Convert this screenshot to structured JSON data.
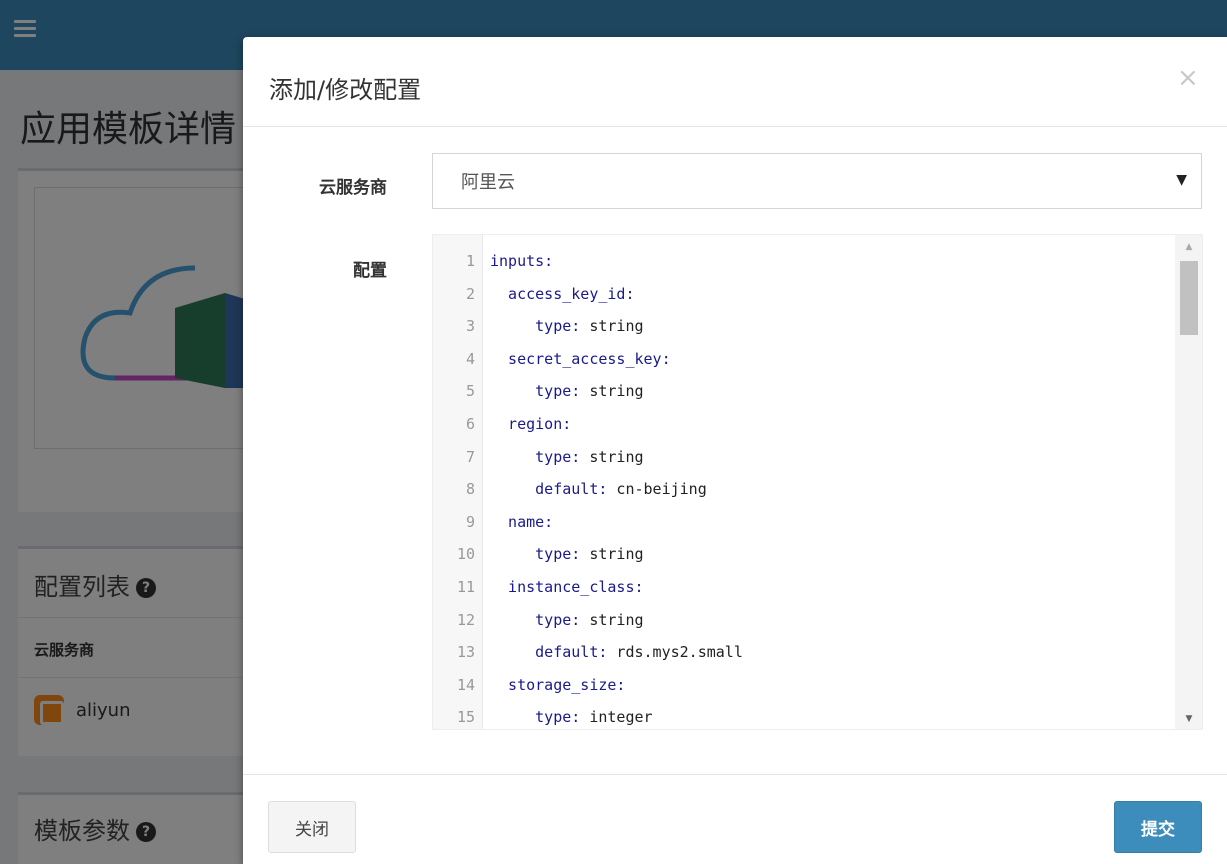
{
  "background": {
    "page_title": "应用模板详情",
    "config_list": {
      "title": "配置列表",
      "column_header": "云服务商",
      "rows": [
        {
          "provider": "aliyun"
        }
      ]
    },
    "params_title": "模板参数"
  },
  "modal": {
    "title": "添加/修改配置",
    "close_icon": "×",
    "provider_label": "云服务商",
    "provider_value": "阿里云",
    "config_label": "配置",
    "config_lines": [
      {
        "n": "1",
        "key": "inputs:",
        "val": ""
      },
      {
        "n": "2",
        "key": "  access_key_id:",
        "val": ""
      },
      {
        "n": "3",
        "key": "     type:",
        "val": " string"
      },
      {
        "n": "4",
        "key": "  secret_access_key:",
        "val": ""
      },
      {
        "n": "5",
        "key": "     type:",
        "val": " string"
      },
      {
        "n": "6",
        "key": "  region:",
        "val": ""
      },
      {
        "n": "7",
        "key": "     type:",
        "val": " string"
      },
      {
        "n": "8",
        "key": "     default:",
        "val": " cn-beijing"
      },
      {
        "n": "9",
        "key": "  name:",
        "val": ""
      },
      {
        "n": "10",
        "key": "     type:",
        "val": " string"
      },
      {
        "n": "11",
        "key": "  instance_class:",
        "val": ""
      },
      {
        "n": "12",
        "key": "     type:",
        "val": " string"
      },
      {
        "n": "13",
        "key": "     default:",
        "val": " rds.mys2.small"
      },
      {
        "n": "14",
        "key": "  storage_size:",
        "val": ""
      },
      {
        "n": "15",
        "key": "     type:",
        "val": " integer"
      }
    ],
    "close_button": "关闭",
    "submit_button": "提交"
  },
  "colors": {
    "primary": "#3c8dbc",
    "backdrop": "rgba(0,0,0,0.5)",
    "yaml_key": "#1a1a8c"
  },
  "icons": [
    "hamburger-icon",
    "help-icon",
    "close-icon",
    "caret-down-icon",
    "provider-logo-icon"
  ]
}
